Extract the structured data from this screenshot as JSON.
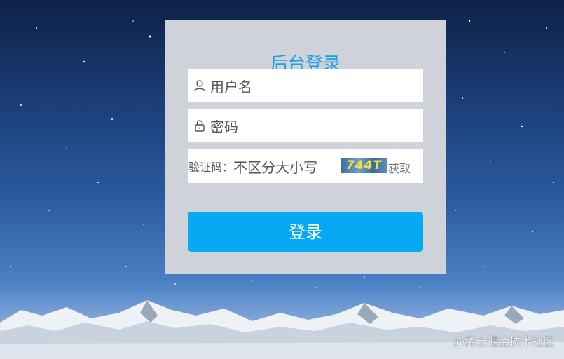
{
  "form": {
    "title": "后台登录",
    "username_placeholder": "用户名",
    "password_placeholder": "密码",
    "captcha_label": "验证码：",
    "captcha_placeholder": "不区分大小写",
    "captcha_code": "744T",
    "captcha_refresh": "获取",
    "login_button": "登录"
  },
  "icons": {
    "username": "user-icon",
    "password": "lock-icon"
  },
  "colors": {
    "title": "#1aa0e8",
    "button": "#05aaf2",
    "panel": "#cfd2d9"
  },
  "watermark": "@稀土掘金技术社区"
}
